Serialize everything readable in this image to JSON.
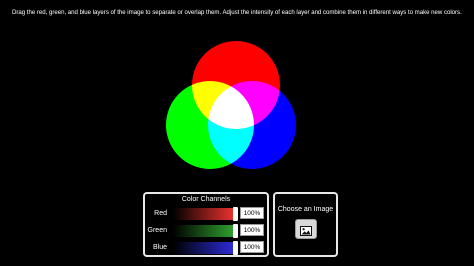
{
  "instructions": "Drag the red, green, and blue layers of the image to separate or overlap them. Adjust the intensity of each layer and combine them in different ways to make new colors.",
  "venn": {
    "circles": [
      {
        "name": "red",
        "color": "#ff0000"
      },
      {
        "name": "green",
        "color": "#00ff00"
      },
      {
        "name": "blue",
        "color": "#0000ff"
      }
    ],
    "overlap_colors": {
      "red_green": "#ffff00",
      "red_blue": "#ff00ff",
      "green_blue": "#00ffff",
      "all": "#ffffff"
    }
  },
  "color_channels": {
    "title": "Color Channels",
    "channels": [
      {
        "label": "Red",
        "value": "100%",
        "level": 1.0,
        "color": "#e8312d"
      },
      {
        "label": "Green",
        "value": "100%",
        "level": 1.0,
        "color": "#2f9e2f"
      },
      {
        "label": "Blue",
        "value": "100%",
        "level": 1.0,
        "color": "#2b2bd6"
      }
    ]
  },
  "image_chooser": {
    "title": "Choose an Image",
    "icon": "image-icon"
  }
}
